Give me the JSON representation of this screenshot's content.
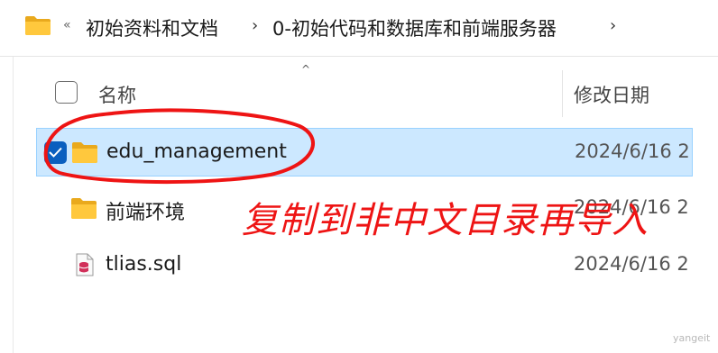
{
  "addressbar": {
    "overflow_glyph": "«",
    "crumbs": [
      "初始资料和文档",
      "0-初始代码和数据库和前端服务器"
    ],
    "chevron": "›"
  },
  "header": {
    "sort_glyph": "^",
    "name_label": "名称",
    "date_label": "修改日期"
  },
  "files": [
    {
      "name": "edu_management",
      "date": "2024/6/16 2",
      "type": "folder",
      "selected": true
    },
    {
      "name": "前端环境",
      "date": "2024/6/16 2",
      "type": "folder",
      "selected": false
    },
    {
      "name": "tlias.sql",
      "date": "2024/6/16 2",
      "type": "sql",
      "selected": false
    }
  ],
  "annotation": {
    "text": "复制到非中文目录再导入",
    "color": "#ee1414"
  },
  "watermark": "yangeit",
  "colors": {
    "selection_bg": "#cce8ff",
    "checkbox_accent": "#0a5fbf",
    "folder_yellow": "#ffc83d",
    "sql_red": "#d1305a"
  }
}
